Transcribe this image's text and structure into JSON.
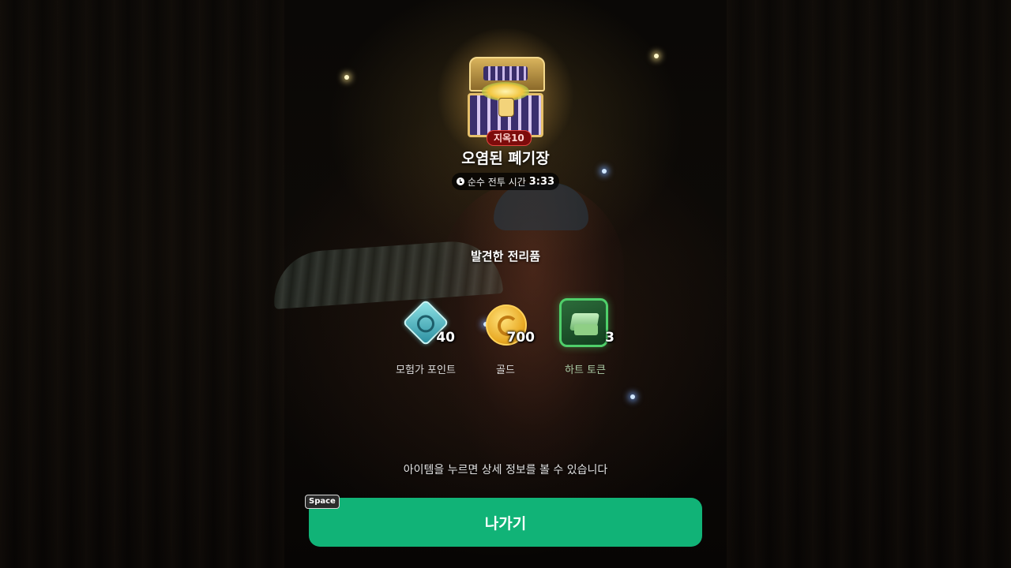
{
  "dungeon": {
    "difficulty_badge": "지옥10",
    "name": "오염된 폐기장",
    "battle_time_label": "순수 전투 시간",
    "battle_time_value": "3:33"
  },
  "loot": {
    "title": "발견한 전리품",
    "items": [
      {
        "label": "모험가 포인트",
        "amount": "40",
        "icon": "adventurer-point-icon"
      },
      {
        "label": "골드",
        "amount": "700",
        "icon": "gold-coin-icon"
      },
      {
        "label": "하트 토큰",
        "amount": "3",
        "icon": "heart-token-icon"
      }
    ]
  },
  "hint": "아이템을 누르면 상세 정보를 볼 수 있습니다",
  "exit_button": {
    "label": "나가기",
    "key_hint": "Space"
  },
  "colors": {
    "accent_green": "#11b377",
    "badge_red": "#7d0b0b"
  }
}
